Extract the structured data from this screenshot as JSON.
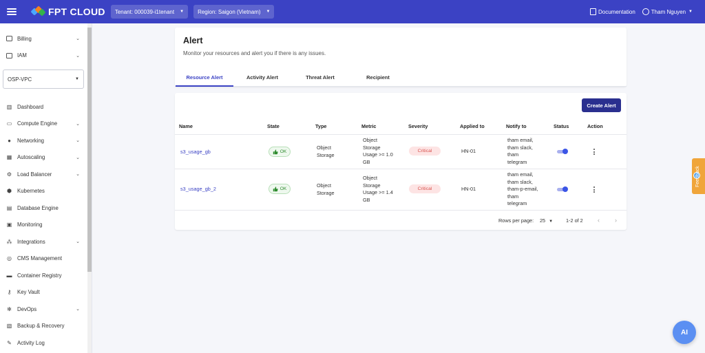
{
  "topbar": {
    "logo_text": "FPT CLOUD",
    "tenant": "Tenant: 000039-i1tenant",
    "region": "Region: Saigon (Vietnam)",
    "documentation": "Documentation",
    "user": "Tham Nguyen",
    "accent_color": "#3b42c4"
  },
  "sidebar": {
    "top_items": [
      {
        "label": "Billing",
        "icon": "billing-icon"
      },
      {
        "label": "IAM",
        "icon": "iam-icon"
      }
    ],
    "vpc_select": "OSP-VPC",
    "items": [
      {
        "label": "Dashboard",
        "icon": "dashboard-icon"
      },
      {
        "label": "Compute Engine",
        "icon": "compute-icon"
      },
      {
        "label": "Networking",
        "icon": "networking-icon"
      },
      {
        "label": "Autoscaling",
        "icon": "autoscaling-icon"
      },
      {
        "label": "Load Balancer",
        "icon": "load-balancer-icon"
      },
      {
        "label": "Kubernetes",
        "icon": "kubernetes-icon"
      },
      {
        "label": "Database Engine",
        "icon": "database-icon"
      },
      {
        "label": "Monitoring",
        "icon": "monitoring-icon"
      },
      {
        "label": "Integrations",
        "icon": "integrations-icon"
      },
      {
        "label": "CMS Management",
        "icon": "cms-icon"
      },
      {
        "label": "Container Registry",
        "icon": "container-icon"
      },
      {
        "label": "Key Vault",
        "icon": "key-icon"
      },
      {
        "label": "DevOps",
        "icon": "devops-icon"
      },
      {
        "label": "Backup & Recovery",
        "icon": "backup-icon"
      },
      {
        "label": "Activity Log",
        "icon": "activity-log-icon"
      }
    ]
  },
  "page": {
    "title": "Alert",
    "subtitle": "Monitor your resources and alert you if there is any issues.",
    "tabs": [
      "Resource Alert",
      "Activity Alert",
      "Threat Alert",
      "Recipient"
    ],
    "create_button": "Create Alert"
  },
  "table": {
    "columns": [
      "Name",
      "State",
      "Type",
      "Metric",
      "Severity",
      "Applied to",
      "Notify to",
      "Status",
      "Action"
    ],
    "rows": [
      {
        "name": "s3_usage_gb",
        "state": "OK",
        "type": [
          "Object",
          "Storage"
        ],
        "metric": [
          "Object",
          "Storage",
          "Usage >= 1.0",
          "GB"
        ],
        "severity": "Critical",
        "applied_to": "HN-01",
        "notify_to": [
          "tham email,",
          "tham slack,",
          "tham",
          "telegram"
        ],
        "status_on": true
      },
      {
        "name": "s3_usage_gb_2",
        "state": "OK",
        "type": [
          "Object",
          "Storage"
        ],
        "metric": [
          "Object",
          "Storage",
          "Usage >= 1.4",
          "GB"
        ],
        "severity": "Critical",
        "applied_to": "HN-01",
        "notify_to": [
          "tham email,",
          "tham slack,",
          "tham-p-email,",
          "tham",
          "telegram"
        ],
        "status_on": true
      }
    ],
    "pagination": {
      "rows_per_page_label": "Rows per page:",
      "rows_per_page": "25",
      "range": "1-2 of 2"
    }
  },
  "feedback_label": "Feedback",
  "ai_label": "AI"
}
